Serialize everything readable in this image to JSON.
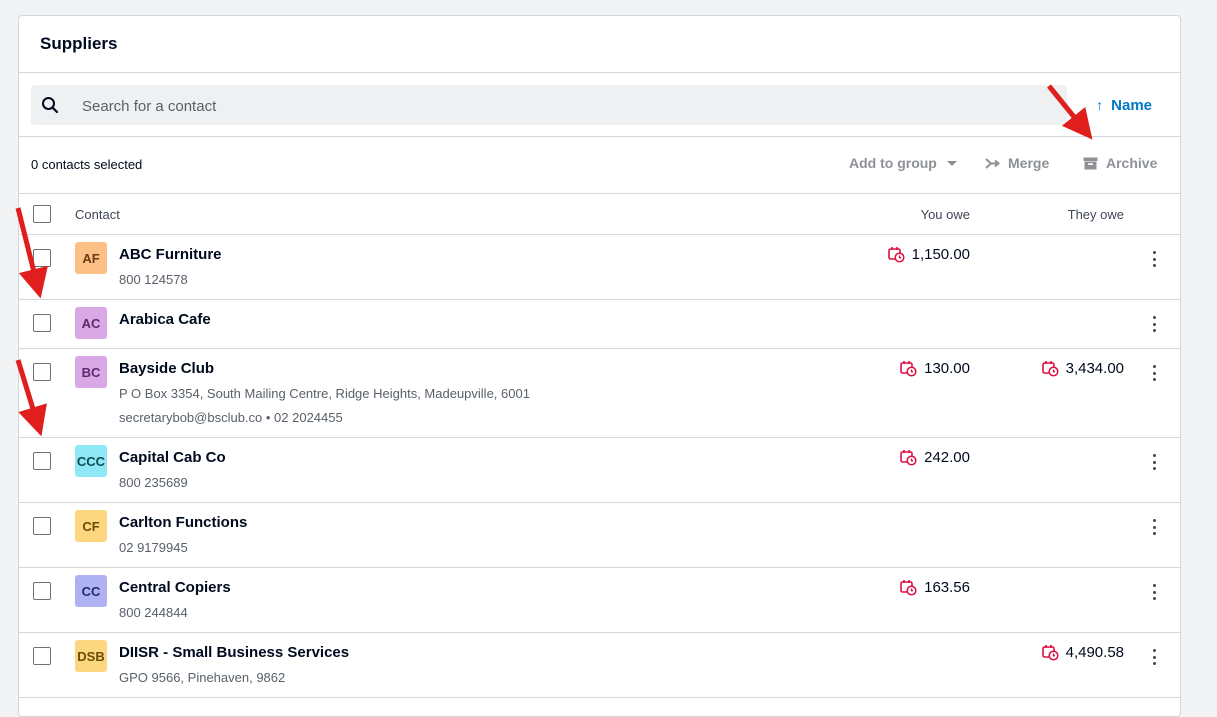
{
  "panel": {
    "title": "Suppliers"
  },
  "search": {
    "placeholder": "Search for a contact",
    "value": ""
  },
  "sort": {
    "label": "Name",
    "arrow": "↑"
  },
  "actions": {
    "selected": "0 contacts selected",
    "add_to_group": "Add to group",
    "merge": "Merge",
    "archive": "Archive"
  },
  "columns": {
    "contact": "Contact",
    "you_owe": "You owe",
    "they_owe": "They owe"
  },
  "rows": [
    {
      "initials": "AF",
      "avatar_bg": "#fcc087",
      "avatar_fg": "#6b3a10",
      "name": "ABC Furniture",
      "line1": "800 124578",
      "line2": "",
      "you_owe": "1,150.00",
      "they_owe": ""
    },
    {
      "initials": "AC",
      "avatar_bg": "#dba8e6",
      "avatar_fg": "#5b2a6b",
      "name": "Arabica Cafe",
      "line1": "",
      "line2": "",
      "you_owe": "",
      "they_owe": ""
    },
    {
      "initials": "BC",
      "avatar_bg": "#dba8e6",
      "avatar_fg": "#5b2a6b",
      "name": "Bayside Club",
      "line1": "P O Box 3354, South Mailing Centre, Ridge Heights, Madeupville, 6001",
      "line2": "secretarybob@bsclub.co  •  02 2024455",
      "you_owe": "130.00",
      "they_owe": "3,434.00"
    },
    {
      "initials": "CCC",
      "avatar_bg": "#8ee8f5",
      "avatar_fg": "#0d4a55",
      "name": "Capital Cab Co",
      "line1": "800 235689",
      "line2": "",
      "you_owe": "242.00",
      "they_owe": ""
    },
    {
      "initials": "CF",
      "avatar_bg": "#fcd77f",
      "avatar_fg": "#6b4c05",
      "name": "Carlton Functions",
      "line1": "02 9179945",
      "line2": "",
      "you_owe": "",
      "they_owe": ""
    },
    {
      "initials": "CC",
      "avatar_bg": "#aeb2f2",
      "avatar_fg": "#262a6b",
      "name": "Central Copiers",
      "line1": "800 244844",
      "line2": "",
      "you_owe": "163.56",
      "they_owe": ""
    },
    {
      "initials": "DSB",
      "avatar_bg": "#fcd77f",
      "avatar_fg": "#6b4c05",
      "name": "DIISR - Small Business Services",
      "line1": "GPO 9566, Pinehaven, 9862",
      "line2": "",
      "you_owe": "",
      "they_owe": "4,490.58"
    }
  ],
  "colors": {
    "overdue": "#de0e40",
    "accent": "#0078c8",
    "annotation": "#e01e1e"
  }
}
